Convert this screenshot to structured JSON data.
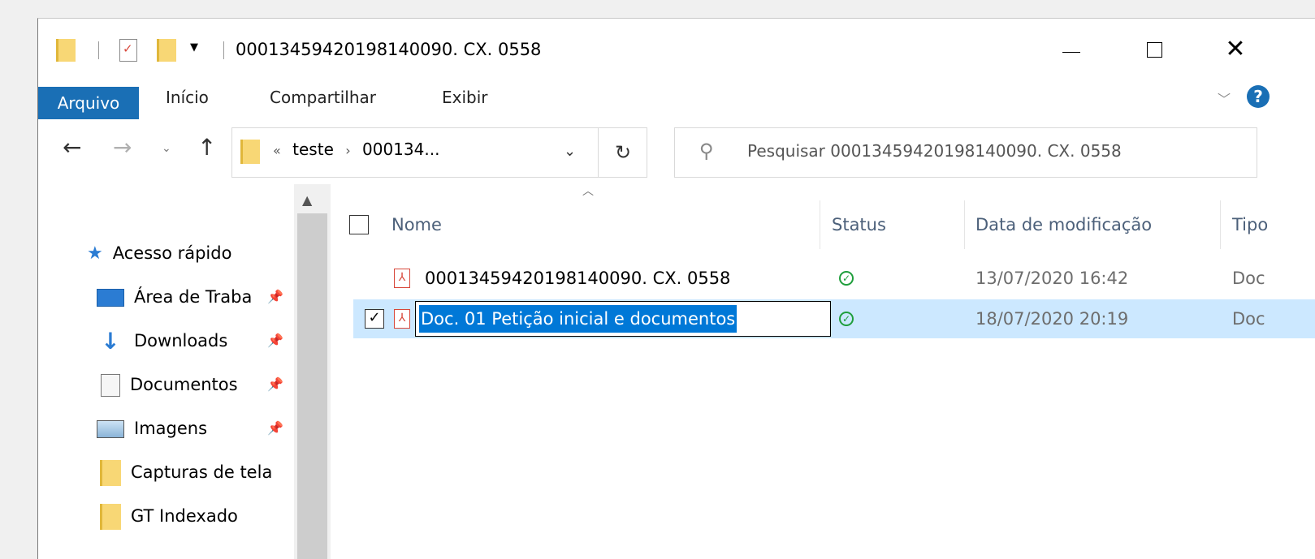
{
  "window": {
    "title": "00013459420198140090. CX. 0558"
  },
  "quick_access_toolbar": {
    "items": [
      "folder-icon",
      "properties-icon",
      "new-folder-icon",
      "customize-dropdown"
    ]
  },
  "title_buttons": {
    "minimize": "minimize-icon",
    "maximize": "maximize-icon",
    "close": "✕"
  },
  "ribbon": {
    "tabs": [
      "Arquivo",
      "Início",
      "Compartilhar",
      "Exibir"
    ],
    "help": "?",
    "expand_chevron": "﹀"
  },
  "navigation": {
    "back": "←",
    "forward": "→",
    "recent": "⌄",
    "up": "↑"
  },
  "address_bar": {
    "overflow": "«",
    "crumbs": [
      "teste",
      "000134..."
    ],
    "separator": "›",
    "dropdown": "⌄",
    "refresh": "↻"
  },
  "search": {
    "placeholder": "Pesquisar 00013459420198140090. CX. 0558"
  },
  "nav_pane": {
    "items": [
      {
        "label": "Acesso rápido",
        "icon": "quick-access-star-icon",
        "pinned": false
      },
      {
        "label": "Área de Traba",
        "icon": "desktop-icon",
        "pinned": true
      },
      {
        "label": "Downloads",
        "icon": "download-arrow-icon",
        "pinned": true
      },
      {
        "label": "Documentos",
        "icon": "documents-icon",
        "pinned": true
      },
      {
        "label": "Imagens",
        "icon": "pictures-icon",
        "pinned": true
      },
      {
        "label": "Capturas de tela",
        "icon": "folder-icon",
        "pinned": false
      },
      {
        "label": "GT Indexado",
        "icon": "folder-icon",
        "pinned": false
      }
    ]
  },
  "file_list": {
    "columns": [
      "Nome",
      "Status",
      "Data de modificação",
      "Tipo"
    ],
    "rows": [
      {
        "name": "00013459420198140090. CX. 0558",
        "status": "ok",
        "modified": "13/07/2020 16:42",
        "type": "Doc",
        "selected": false
      },
      {
        "name": "Doc. 01 Petição inicial e documentos",
        "status": "ok",
        "modified": "18/07/2020 20:19",
        "type": "Doc",
        "selected": true,
        "renaming": true
      }
    ]
  },
  "colors": {
    "accent": "#1a6fb5",
    "selection": "#cce8ff",
    "rename_highlight": "#0078d7",
    "pdf_red": "#d8473a",
    "status_green": "#1f9e3c",
    "folder_yellow": "#f8d775"
  }
}
